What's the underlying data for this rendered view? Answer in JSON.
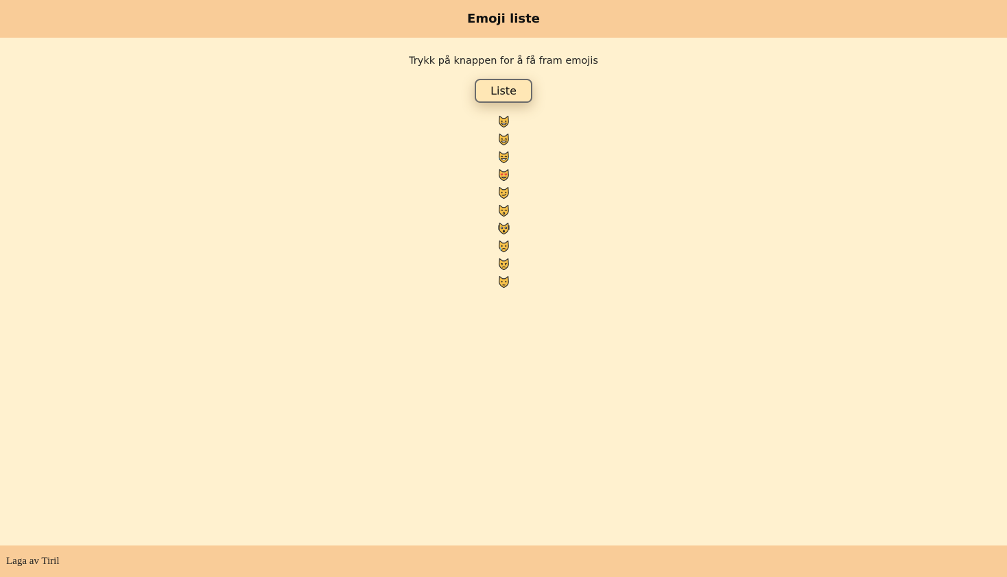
{
  "header": {
    "title": "Emoji liste"
  },
  "main": {
    "instruction": "Trykk på knappen for å få fram emojis",
    "button_label": "Liste",
    "emojis": [
      {
        "name": "grinning-cat-icon",
        "char": "😺"
      },
      {
        "name": "grinning-cat-smiling-eyes-icon",
        "char": "😸"
      },
      {
        "name": "cat-tears-of-joy-icon",
        "char": "😹"
      },
      {
        "name": "smiling-cat-heart-eyes-icon",
        "char": "😻"
      },
      {
        "name": "cat-wry-smile-icon",
        "char": "😼"
      },
      {
        "name": "kissing-cat-icon",
        "char": "😽"
      },
      {
        "name": "weary-cat-icon",
        "char": "🙀"
      },
      {
        "name": "crying-cat-icon",
        "char": "😿"
      },
      {
        "name": "pouting-cat-icon",
        "char": "😾"
      },
      {
        "name": "cat-face-icon",
        "char": "🐱"
      }
    ]
  },
  "footer": {
    "text": "Laga av Tiril"
  },
  "colors": {
    "header_bg": "#F9CC98",
    "page_bg": "#FFF1CF",
    "button_bg": "#FFE7B5"
  }
}
